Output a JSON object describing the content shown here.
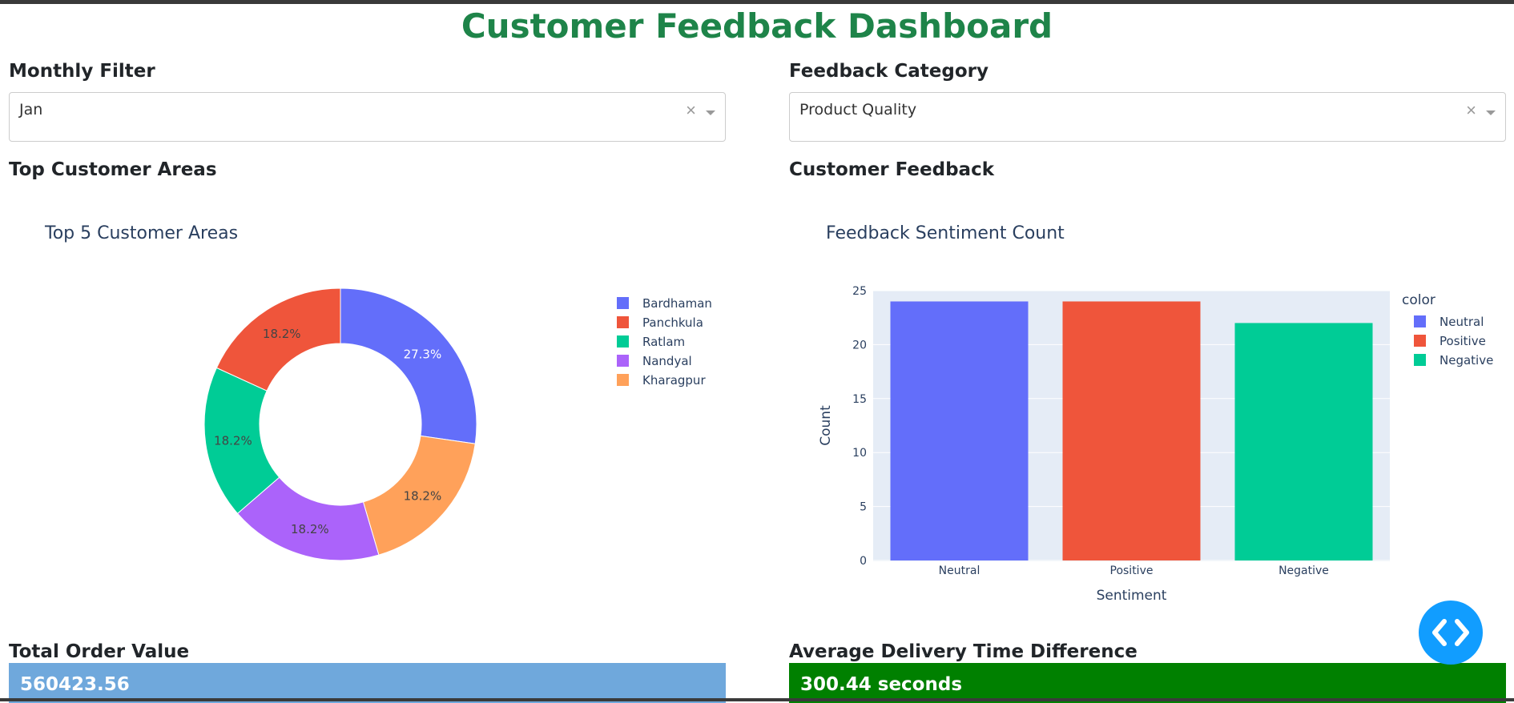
{
  "title": "Customer Feedback Dashboard",
  "filters": {
    "monthly": {
      "label": "Monthly Filter",
      "value": "Jan",
      "clear": "×"
    },
    "category": {
      "label": "Feedback Category",
      "value": "Product Quality",
      "clear": "×"
    }
  },
  "sections": {
    "areas": "Top Customer Areas",
    "feedback": "Customer Feedback"
  },
  "colors": {
    "title": "#1e8449",
    "kpi_order": "#6fa8dc",
    "kpi_delivery": "#008000",
    "fab": "#119dff"
  },
  "chart_data": [
    {
      "type": "pie",
      "title": "Top 5 Customer Areas",
      "hole": true,
      "labels": [
        "Bardhaman",
        "Panchkula",
        "Ratlam",
        "Nandyal",
        "Kharagpur"
      ],
      "values": [
        27.3,
        18.2,
        18.2,
        18.2,
        18.2
      ],
      "value_labels": [
        "27.3%",
        "18.2%",
        "18.2%",
        "18.2%",
        "18.2%"
      ],
      "colors": [
        "#636efa",
        "#ef553b",
        "#00cc96",
        "#ab63fa",
        "#ffa15a"
      ],
      "legend": "right"
    },
    {
      "type": "bar",
      "title": "Feedback Sentiment Count",
      "categories": [
        "Neutral",
        "Positive",
        "Negative"
      ],
      "values": [
        24,
        24,
        22
      ],
      "colors": [
        "#636efa",
        "#ef553b",
        "#00cc96"
      ],
      "xlabel": "Sentiment",
      "ylabel": "Count",
      "ylim": [
        0,
        25
      ],
      "yticks": [
        0,
        5,
        10,
        15,
        20,
        25
      ],
      "legend_title": "color",
      "legend": "top-right",
      "grid": true
    }
  ],
  "kpis": {
    "order": {
      "label": "Total Order Value",
      "value": "560423.56"
    },
    "delivery": {
      "label": "Average Delivery Time Difference",
      "value": "300.44 seconds"
    }
  }
}
